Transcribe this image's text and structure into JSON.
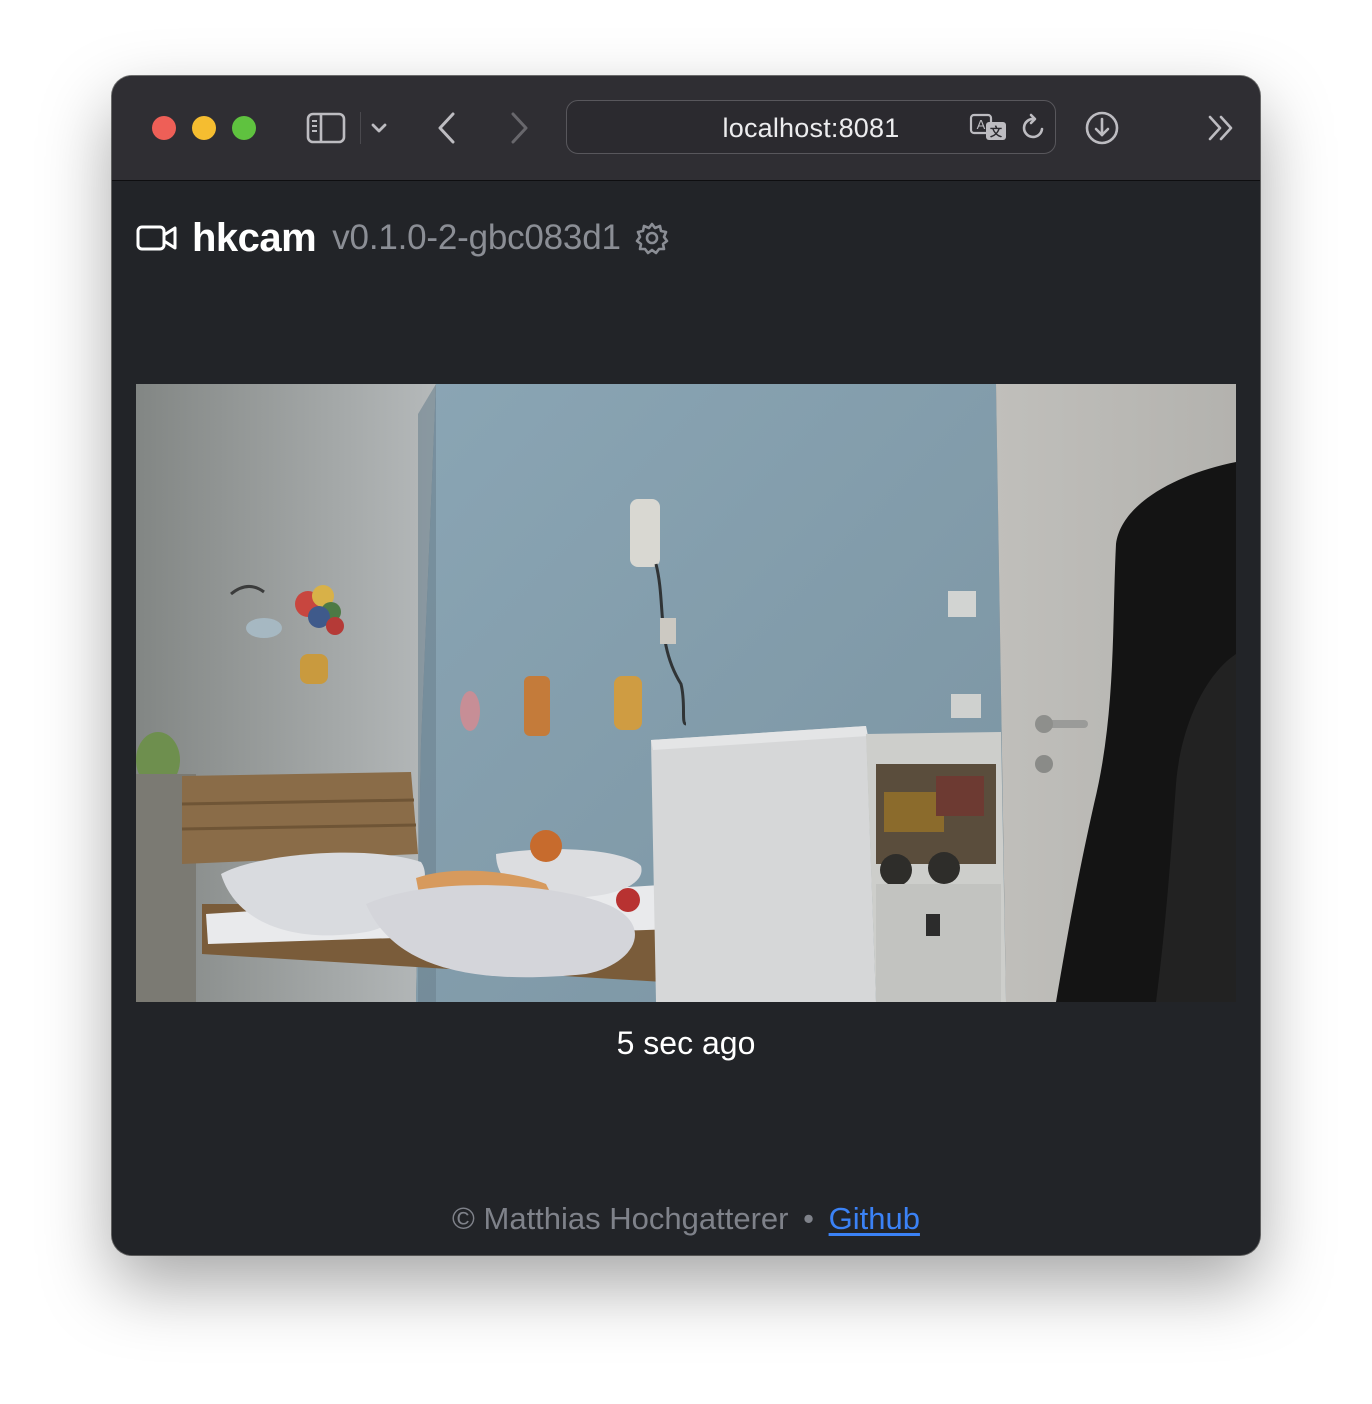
{
  "browser": {
    "url": "localhost:8081",
    "icons": {
      "sidebar": "sidebar-icon",
      "sidebar_menu": "chevron-down-icon",
      "back": "chevron-left-icon",
      "forward": "chevron-right-icon",
      "translate": "translate-icon",
      "reload": "reload-icon",
      "downloads": "download-icon",
      "more": "double-chevron-right-icon"
    }
  },
  "header": {
    "title": "hkcam",
    "version": "v0.1.0-2-gbc083d1"
  },
  "camera": {
    "timestamp": "5 sec ago"
  },
  "footer": {
    "copyright": "© Matthias Hochgatterer",
    "separator": "•",
    "link_label": "Github"
  },
  "colors": {
    "page_background": "#222428",
    "toolbar_background": "#2f2e33",
    "link": "#3b82f6",
    "muted_text": "#8b8e95",
    "close": "#ee5f57",
    "minimize": "#f5bd30",
    "maximize": "#5fc23f"
  }
}
